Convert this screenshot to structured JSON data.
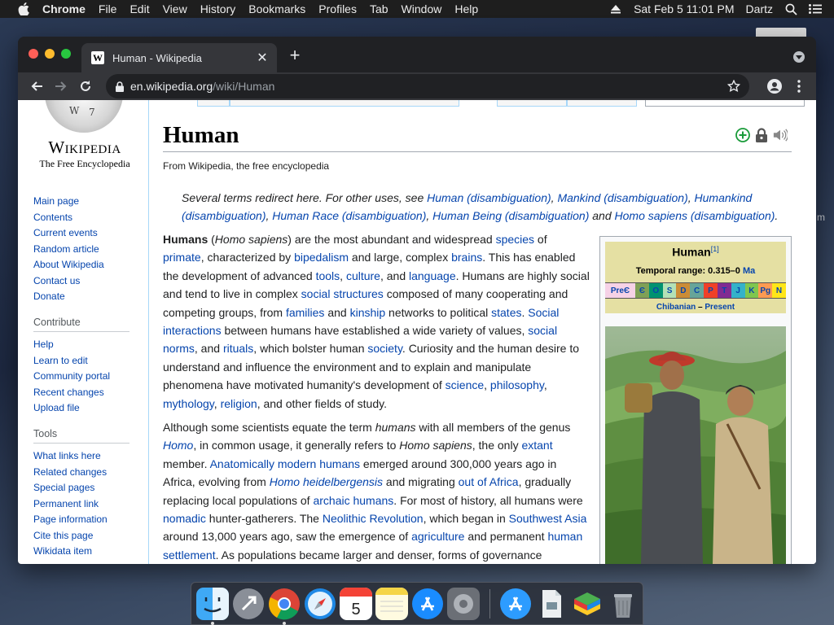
{
  "menubar": {
    "app": "Chrome",
    "items": [
      "File",
      "Edit",
      "View",
      "History",
      "Bookmarks",
      "Profiles",
      "Tab",
      "Window",
      "Help"
    ],
    "datetime": "Sat Feb 5  11:01 PM",
    "user": "Dartz"
  },
  "browser": {
    "tab_title": "Human - Wikipedia",
    "favicon": "W",
    "url_host": "en.wikipedia.org",
    "url_path": "/wiki/Human"
  },
  "sidebar": {
    "wordmark": "Wikipedia",
    "tagline": "The Free Encyclopedia",
    "main_links": [
      "Main page",
      "Contents",
      "Current events",
      "Random article",
      "About Wikipedia",
      "Contact us",
      "Donate"
    ],
    "contribute_heading": "Contribute",
    "contribute_links": [
      "Help",
      "Learn to edit",
      "Community portal",
      "Recent changes",
      "Upload file"
    ],
    "tools_heading": "Tools",
    "tools_links": [
      "What links here",
      "Related changes",
      "Special pages",
      "Permanent link",
      "Page information",
      "Cite this page",
      "Wikidata item"
    ]
  },
  "article": {
    "title": "Human",
    "site_sub": "From Wikipedia, the free encyclopedia",
    "hatnote": {
      "prefix": "Several terms redirect here. For other uses, see ",
      "links": [
        "Human (disambiguation)",
        "Mankind (disambiguation)",
        "Humankind (disambiguation)",
        "Human Race (disambiguation)",
        "Human Being (disambiguation)",
        "Homo sapiens (disambiguation)"
      ],
      "and": "and"
    }
  },
  "infobox": {
    "title": "Human",
    "ref": "[1]",
    "range_label": "Temporal range: 0.315–0",
    "range_unit": "Ma",
    "timeline": [
      "PreЄ",
      "Є",
      "O",
      "S",
      "D",
      "C",
      "P",
      "T",
      "J",
      "K",
      "Pg",
      "N"
    ],
    "stage_start": "Chibanian",
    "stage_end": "Present"
  },
  "colors": {
    "link": "#0645ad",
    "infobox_header": "#e5e0a3"
  }
}
